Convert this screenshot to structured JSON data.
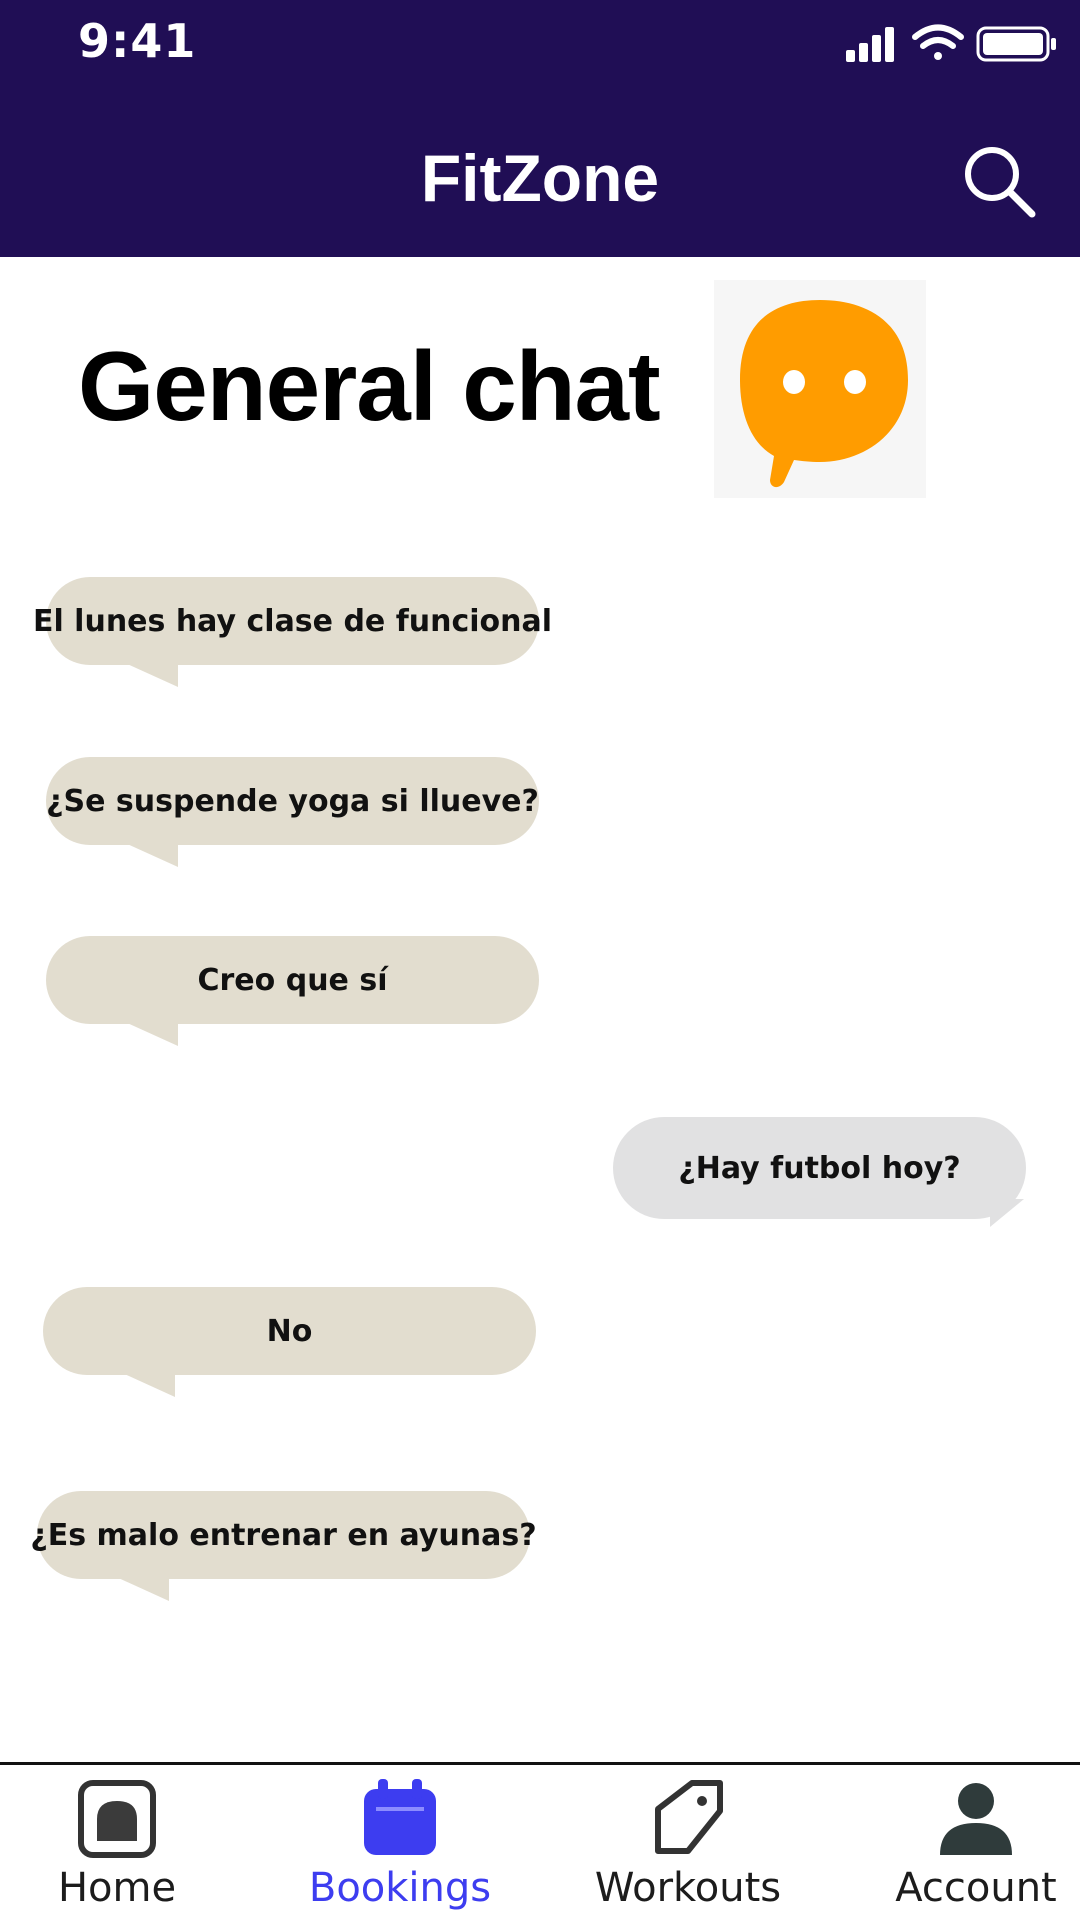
{
  "status_bar": {
    "time": "9:41"
  },
  "header": {
    "title": "FitZone",
    "search_icon": "search-icon"
  },
  "page": {
    "heading": "General chat",
    "logo_icon": "chat-bubble-icon"
  },
  "messages": [
    {
      "text": "El lunes hay clase de funcional",
      "from": "other"
    },
    {
      "text": "¿Se suspende yoga si llueve?",
      "from": "other"
    },
    {
      "text": "Creo que sí",
      "from": "other"
    },
    {
      "text": "¿Hay futbol hoy?",
      "from": "me"
    },
    {
      "text": "No",
      "from": "other"
    },
    {
      "text": "¿Es malo entrenar en ayunas?",
      "from": "other"
    }
  ],
  "bottom_nav": {
    "items": [
      {
        "label": "Home",
        "icon": "home-icon",
        "active": false
      },
      {
        "label": "Bookings",
        "icon": "calendar-icon",
        "active": true
      },
      {
        "label": "Workouts",
        "icon": "tag-icon",
        "active": false
      },
      {
        "label": "Account",
        "icon": "person-icon",
        "active": false
      }
    ]
  },
  "colors": {
    "header_bg": "#200e55",
    "bubble_other": "#e2ddcf",
    "bubble_me": "#e1e1e2",
    "active_nav": "#3d3df0",
    "logo_orange": "#ff9c00"
  }
}
